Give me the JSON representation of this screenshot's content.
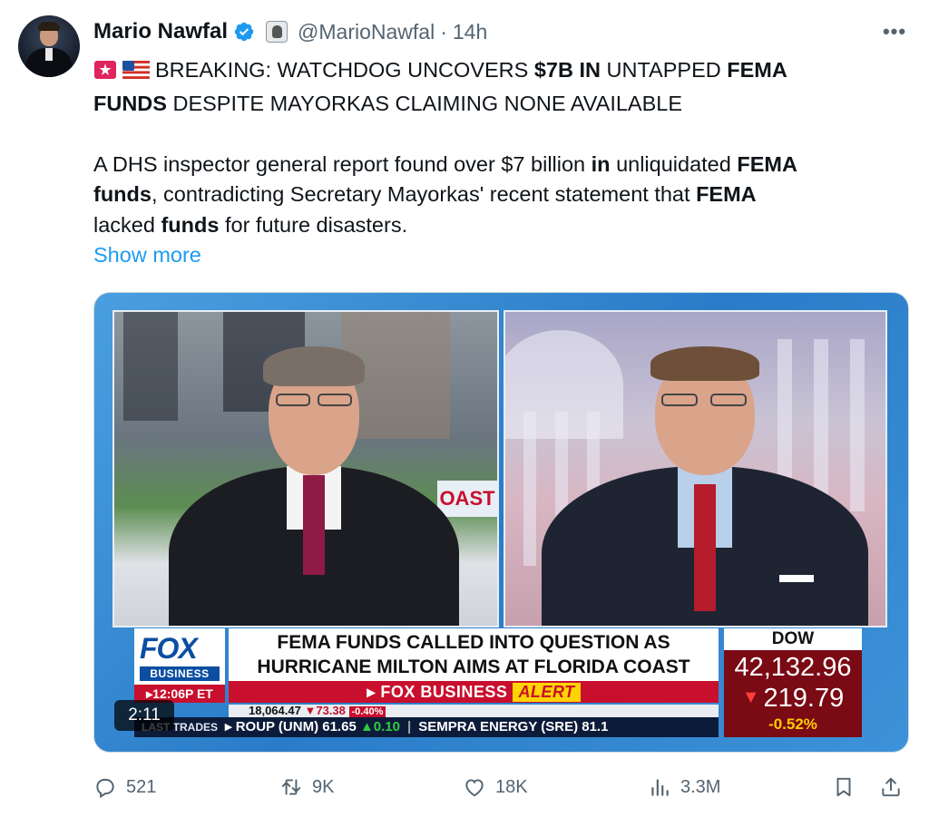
{
  "tweet": {
    "author_name": "Mario Nawfal",
    "handle": "@MarioNawfal",
    "separator": "·",
    "time": "14h",
    "more_label": "•••",
    "text": {
      "line1_a": "BREAKING: WATCHDOG UNCOVERS ",
      "line1_b": "$7B IN",
      "line1_c": " UNTAPPED ",
      "line1_d": "FEMA",
      "line2_a": "FUNDS",
      "line2_b": " DESPITE MAYORKAS CLAIMING NONE AVAILABLE",
      "line3_a": "A DHS inspector general report found over $7 billion ",
      "line3_b": "in",
      "line3_c": " unliquidated ",
      "line3_d": "FEMA",
      "line4_a": "funds",
      "line4_b": ", contradicting Secretary Mayorkas' recent statement that ",
      "line4_c": "FEMA",
      "line5_a": "lacked ",
      "line5_b": "funds",
      "line5_c": " for future disasters."
    },
    "show_more": "Show more"
  },
  "media": {
    "duration": "2:11",
    "coast_sign": "OAST",
    "fox_logo_text": "FOX",
    "fox_business_text": "BUSINESS",
    "clock": "▸12:06P ET",
    "headline_line1": "FEMA FUNDS CALLED INTO QUESTION AS",
    "headline_line2": "HURRICANE MILTON AIMS AT FLORIDA COAST",
    "alert_brand": "▸ FOX BUSINESS",
    "alert_word": "ALERT",
    "dow_label": "DOW",
    "dow_value": "42,132.96",
    "dow_change": "219.79",
    "dow_pct": "-0.52%",
    "ticker_top_a": "18,064.47",
    "ticker_top_b": "▼73.38",
    "ticker_top_c": "-0.40%",
    "ticker_label": "LAST TRADES",
    "ticker_bottom_a": "▸ ROUP (UNM)  61.65 ",
    "ticker_bottom_up": "▲0.10",
    "ticker_bottom_sep": "|",
    "ticker_bottom_b": "SEMPRA ENERGY (SRE)  81.1"
  },
  "actions": {
    "replies": "521",
    "reposts": "9K",
    "likes": "18K",
    "views": "3.3M"
  },
  "colors": {
    "accent": "#1d9bf0",
    "verified": "#1d9bf0",
    "fox_red": "#c8102e",
    "fox_blue": "#0b4ea2"
  },
  "icons": [
    "verified-badge-icon",
    "affiliate-badge-icon",
    "more-icon",
    "siren-emoji-icon",
    "us-flag-emoji-icon",
    "reply-icon",
    "repost-icon",
    "like-icon",
    "views-icon",
    "bookmark-icon",
    "share-icon"
  ]
}
